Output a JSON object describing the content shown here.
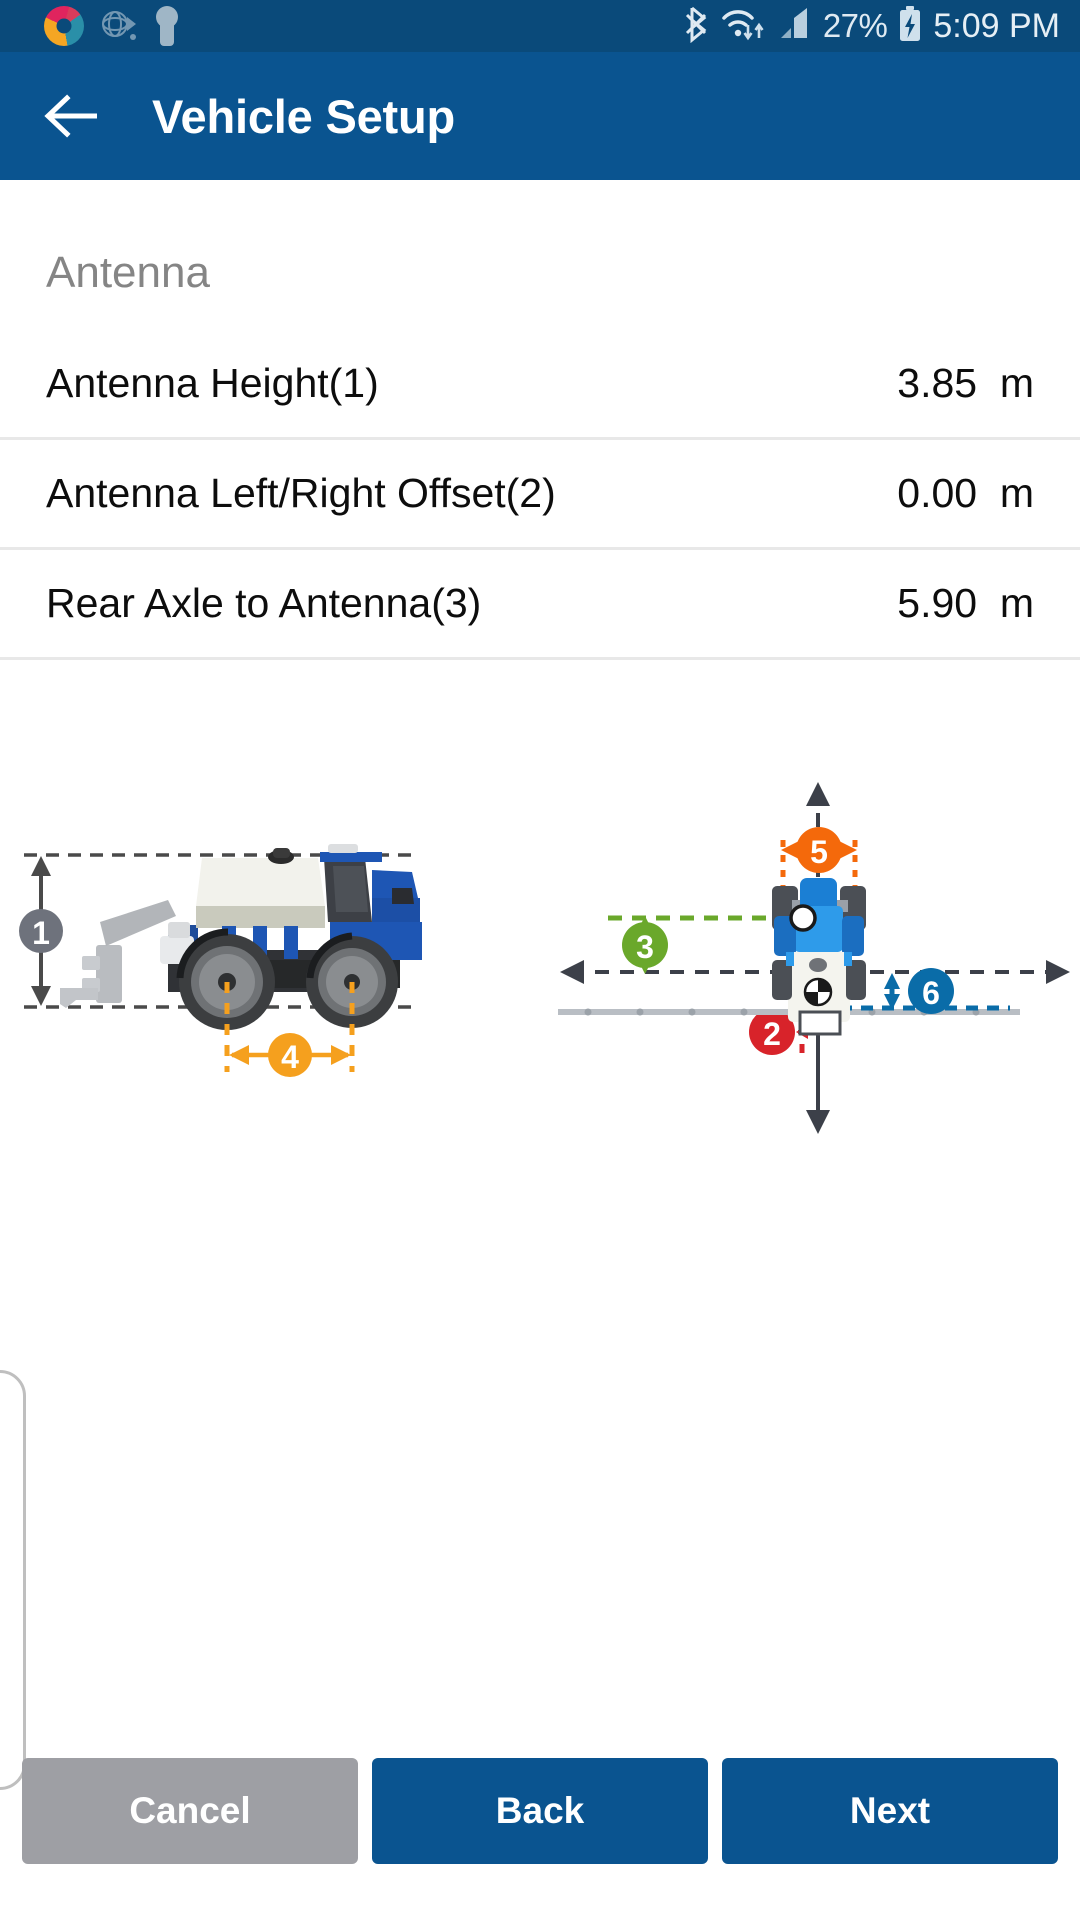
{
  "statusbar": {
    "icons_left": [
      "chrome-logo-icon",
      "globe-icon",
      "keyhole-icon"
    ],
    "icons_right": [
      "bluetooth-icon",
      "wifi-icon",
      "cellular-signal-icon",
      "battery-charging-icon"
    ],
    "battery_percent": "27%",
    "time": "5:09 PM",
    "background": "#0a4a7a"
  },
  "header": {
    "back_icon": "arrow-left-icon",
    "title": "Vehicle Setup",
    "background": "#0a5490"
  },
  "section": {
    "label": "Antenna"
  },
  "rows": [
    {
      "label": "Antenna Height(1)",
      "value": "3.85  m"
    },
    {
      "label": "Antenna Left/Right Offset(2)",
      "value": "0.00  m"
    },
    {
      "label": "Rear Axle to Antenna(3)",
      "value": "5.90  m"
    }
  ],
  "diagram": {
    "side_view_markers": [
      {
        "id": "1",
        "color": "#6e727c",
        "meaning": "antenna-height"
      },
      {
        "id": "4",
        "color": "#f5a01e",
        "meaning": "wheelbase"
      }
    ],
    "top_view_markers": [
      {
        "id": "5",
        "color": "#f4690b",
        "meaning": "track-width"
      },
      {
        "id": "3",
        "color": "#6aa82b",
        "meaning": "rear-axle-to-antenna"
      },
      {
        "id": "2",
        "color": "#d8232a",
        "meaning": "antenna-left-right-offset"
      },
      {
        "id": "6",
        "color": "#0a6ca8",
        "meaning": "implement-offset"
      }
    ]
  },
  "buttons": {
    "cancel": "Cancel",
    "back": "Back",
    "next": "Next",
    "cancel_color": "#9e9fa4",
    "primary_color": "#0a5490"
  }
}
